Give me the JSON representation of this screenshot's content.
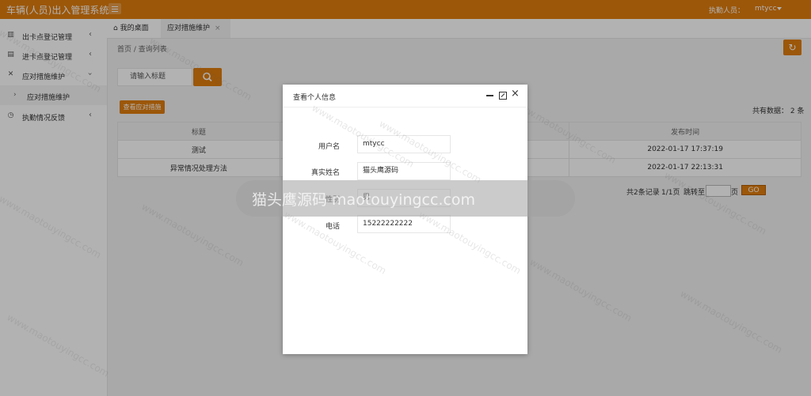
{
  "header": {
    "title": "车辆(人员)出入管理系统",
    "duty_label": "执勤人员：",
    "user": "mtycc"
  },
  "sidebar": {
    "items": [
      {
        "label": "出卡点登记管理",
        "icon": "building-icon"
      },
      {
        "label": "进卡点登记管理",
        "icon": "list-icon"
      },
      {
        "label": "应对措施维护",
        "icon": "tools-icon"
      },
      {
        "label": "应对措施维护",
        "icon": "sub-arrow-icon"
      },
      {
        "label": "执勤情况反馈",
        "icon": "clock-icon"
      }
    ]
  },
  "tabs": {
    "home": "我的桌面",
    "active": "应对措施维护"
  },
  "breadcrumb": "首页  /  查询列表",
  "search": {
    "placeholder": "请输入标题",
    "add_button": "查看应对措施"
  },
  "total": "共有数据：  2 条",
  "table": {
    "headers": [
      "标题",
      "发布时间"
    ],
    "rows": [
      [
        "测试",
        "2022-01-17 17:37:19"
      ],
      [
        "异常情况处理方法",
        "2022-01-17 22:13:31"
      ]
    ]
  },
  "pagination": {
    "summary": "共2条记录",
    "current": "1/1页",
    "jump": "跳转至",
    "suffix": "页",
    "go": "GO"
  },
  "modal": {
    "title": "查看个人信息",
    "fields": [
      {
        "label": "用户名",
        "value": "mtycc"
      },
      {
        "label": "真实姓名",
        "value": "猫头鹰源码"
      },
      {
        "label": "性别",
        "value": "男"
      },
      {
        "label": "电话",
        "value": "15222222222"
      }
    ]
  },
  "watermark": {
    "text": "www.maotouyingcc.com",
    "banner": "猫头鹰源码 maotouyingcc.com"
  },
  "colors": {
    "accent": "#e07d0e"
  }
}
